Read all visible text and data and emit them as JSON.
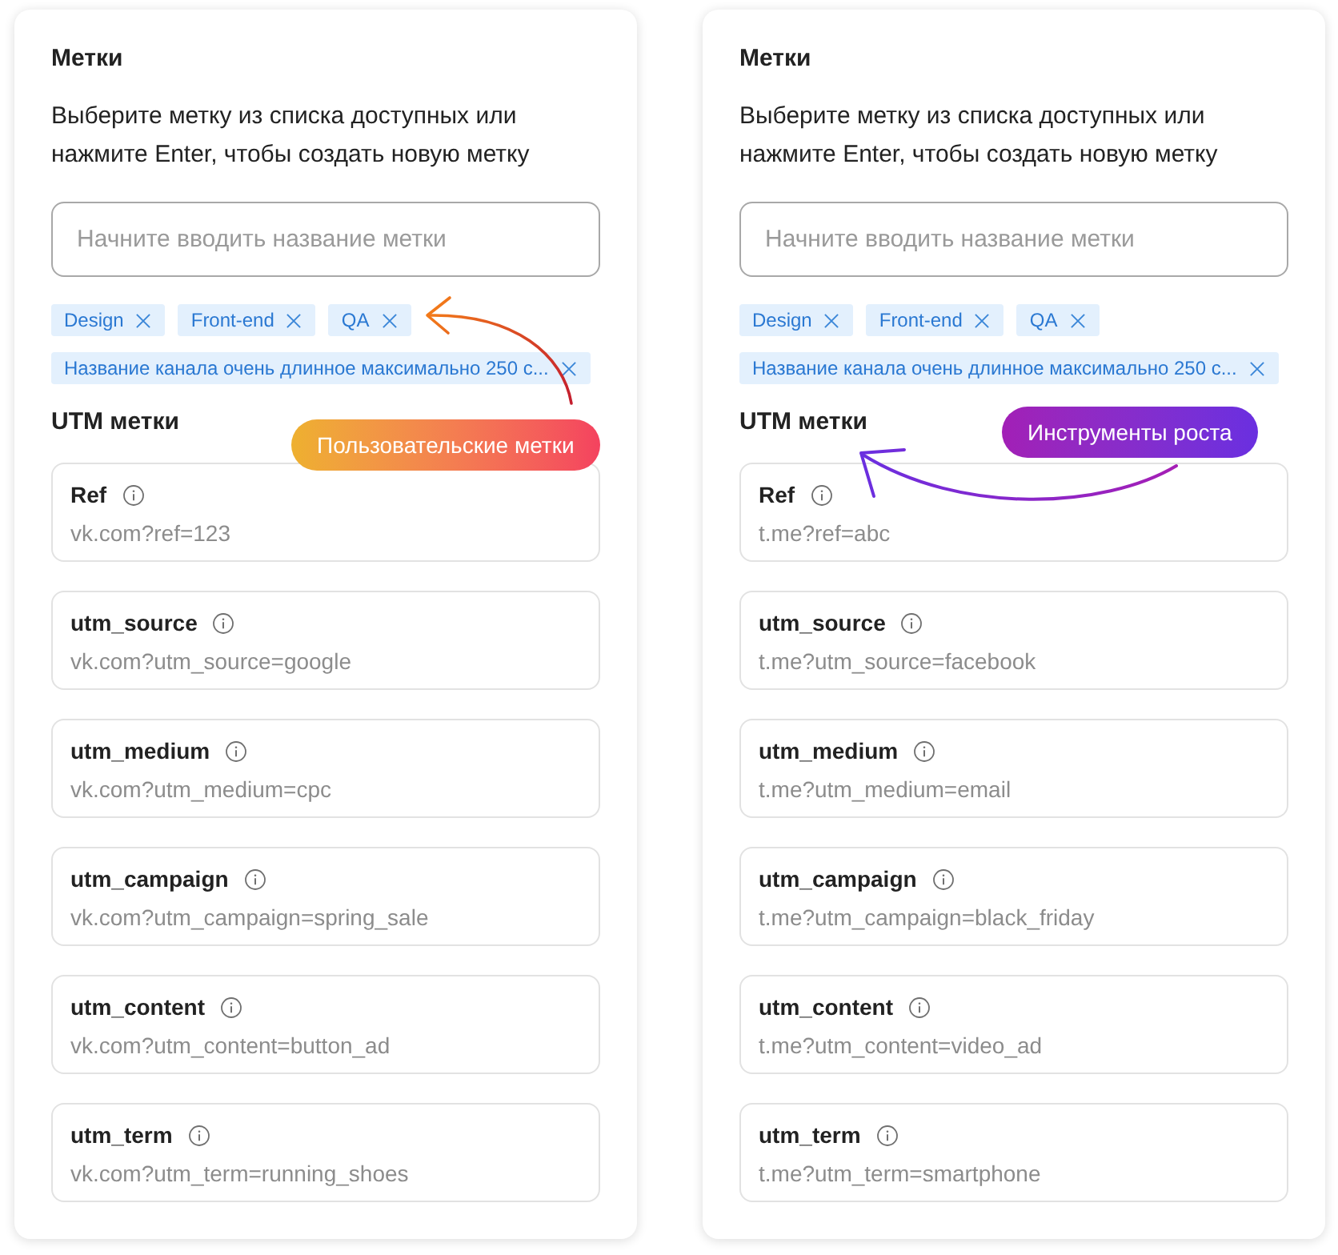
{
  "panels": [
    {
      "title": "Метки",
      "description": "Выберите метку из списка доступных или нажмите Enter, чтобы создать новую метку",
      "tag_input": {
        "placeholder": "Начните вводить название метки"
      },
      "tags": [
        {
          "label": "Design"
        },
        {
          "label": "Front-end"
        },
        {
          "label": "QA"
        },
        {
          "label": "Название канала очень длинное максимально 250 с..."
        }
      ],
      "utm_title": "UTM метки",
      "utm_fields": [
        {
          "name": "Ref",
          "value": "vk.com?ref=123"
        },
        {
          "name": "utm_source",
          "value": "vk.com?utm_source=google"
        },
        {
          "name": "utm_medium",
          "value": "vk.com?utm_medium=cpc"
        },
        {
          "name": "utm_campaign",
          "value": "vk.com?utm_campaign=spring_sale"
        },
        {
          "name": "utm_content",
          "value": "vk.com?utm_content=button_ad"
        },
        {
          "name": "utm_term",
          "value": "vk.com?utm_term=running_shoes"
        }
      ],
      "callout": {
        "label": "Пользовательские метки"
      }
    },
    {
      "title": "Метки",
      "description": "Выберите метку из списка доступных или нажмите Enter, чтобы создать новую метку",
      "tag_input": {
        "placeholder": "Начните вводить название метки"
      },
      "tags": [
        {
          "label": "Design"
        },
        {
          "label": "Front-end"
        },
        {
          "label": "QA"
        },
        {
          "label": "Название канала очень длинное максимально 250 с..."
        }
      ],
      "utm_title": "UTM метки",
      "utm_fields": [
        {
          "name": "Ref",
          "value": "t.me?ref=abc"
        },
        {
          "name": "utm_source",
          "value": "t.me?utm_source=facebook"
        },
        {
          "name": "utm_medium",
          "value": "t.me?utm_medium=email"
        },
        {
          "name": "utm_campaign",
          "value": "t.me?utm_campaign=black_friday"
        },
        {
          "name": "utm_content",
          "value": "t.me?utm_content=video_ad"
        },
        {
          "name": "utm_term",
          "value": "t.me?utm_term=smartphone"
        }
      ],
      "callout": {
        "label": "Инструменты роста"
      }
    }
  ]
}
